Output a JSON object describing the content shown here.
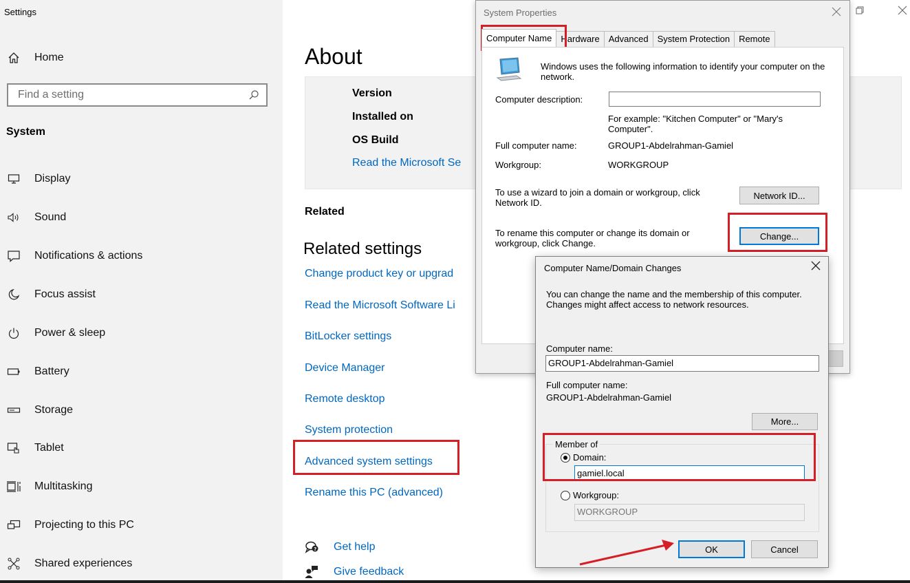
{
  "app": {
    "title": "Settings"
  },
  "sidebar": {
    "home_label": "Home",
    "search_placeholder": "Find a setting",
    "section_label": "System",
    "items": [
      {
        "label": "Display",
        "icon": "monitor-icon"
      },
      {
        "label": "Sound",
        "icon": "speaker-icon"
      },
      {
        "label": "Notifications & actions",
        "icon": "notification-icon"
      },
      {
        "label": "Focus assist",
        "icon": "moon-icon"
      },
      {
        "label": "Power & sleep",
        "icon": "power-icon"
      },
      {
        "label": "Battery",
        "icon": "battery-icon"
      },
      {
        "label": "Storage",
        "icon": "storage-icon"
      },
      {
        "label": "Tablet",
        "icon": "tablet-icon"
      },
      {
        "label": "Multitasking",
        "icon": "multitasking-icon"
      },
      {
        "label": "Projecting to this PC",
        "icon": "projecting-icon"
      },
      {
        "label": "Shared experiences",
        "icon": "shared-experiences-icon"
      }
    ]
  },
  "about": {
    "title": "About",
    "spec_labels": [
      "Version",
      "Installed on",
      "OS Build"
    ],
    "spec_link": "Read the Microsoft Se",
    "related_heading": "Related",
    "related_settings_heading": "Related settings",
    "related_links": [
      "Change product key or upgrad",
      "Read the Microsoft Software Li",
      "BitLocker settings",
      "Device Manager",
      "Remote desktop",
      "System protection",
      "Advanced system settings",
      "Rename this PC (advanced)"
    ],
    "get_help": "Get help",
    "give_feedback": "Give feedback"
  },
  "system_properties": {
    "title": "System Properties",
    "tabs": [
      "Computer Name",
      "Hardware",
      "Advanced",
      "System Protection",
      "Remote"
    ],
    "intro": "Windows uses the following information to identify your computer on the network.",
    "description_label": "Computer description:",
    "description_value": "",
    "example_text": "For example: \"Kitchen Computer\" or \"Mary's Computer\".",
    "full_name_label": "Full computer name:",
    "full_name_value": "GROUP1-Abdelrahman-Gamiel",
    "workgroup_label": "Workgroup:",
    "workgroup_value": "WORKGROUP",
    "wizard_text": "To use a wizard to join a domain or workgroup, click Network ID.",
    "network_id_button": "Network ID...",
    "rename_text": "To rename this computer or change its domain or workgroup, click Change.",
    "change_button": "Change..."
  },
  "domain_changes": {
    "title": "Computer Name/Domain Changes",
    "intro": "You can change the name and the membership of this computer. Changes might affect access to network resources.",
    "computer_name_label": "Computer name:",
    "computer_name_value": "GROUP1-Abdelrahman-Gamiel",
    "full_name_label": "Full computer name:",
    "full_name_value": "GROUP1-Abdelrahman-Gamiel",
    "more_button": "More...",
    "member_of_label": "Member of",
    "domain_label": "Domain:",
    "domain_value": "gamiel.local",
    "workgroup_label": "Workgroup:",
    "workgroup_value": "WORKGROUP",
    "selected_option": "Domain",
    "ok_button": "OK",
    "cancel_button": "Cancel"
  },
  "colors": {
    "link": "#0067c0",
    "highlight": "#d41f26",
    "focus_border": "#0078d7"
  }
}
